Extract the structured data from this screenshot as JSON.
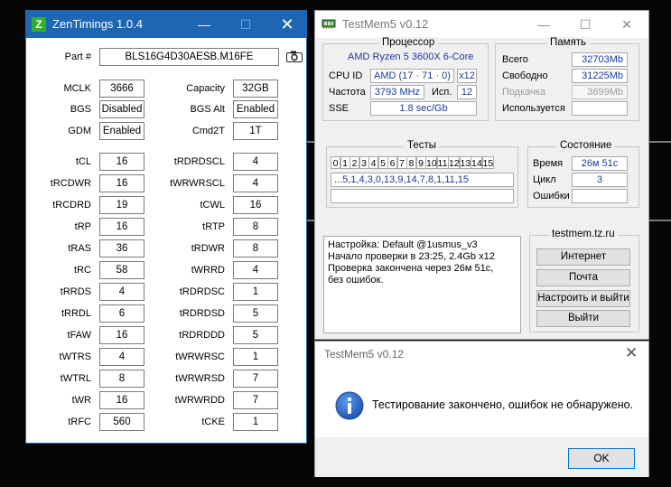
{
  "zentimings": {
    "title": "ZenTimings 1.0.4",
    "logo_letter": "Z",
    "controls": {
      "minimize": "—",
      "maximize": "☐",
      "close": "✕"
    },
    "part_label": "Part #",
    "part_value": "BLS16G4D30AESB.M16FE",
    "top_rows": [
      {
        "l_label": "MCLK",
        "l_value": "3666",
        "r_label": "Capacity",
        "r_value": "32GB"
      },
      {
        "l_label": "BGS",
        "l_value": "Disabled",
        "r_label": "BGS Alt",
        "r_value": "Enabled"
      },
      {
        "l_label": "GDM",
        "l_value": "Enabled",
        "r_label": "Cmd2T",
        "r_value": "1T"
      }
    ],
    "timing_rows": [
      {
        "l_label": "tCL",
        "l_value": "16",
        "r_label": "tRDRDSCL",
        "r_value": "4"
      },
      {
        "l_label": "tRCDWR",
        "l_value": "16",
        "r_label": "tWRWRSCL",
        "r_value": "4"
      },
      {
        "l_label": "tRCDRD",
        "l_value": "19",
        "r_label": "tCWL",
        "r_value": "16"
      },
      {
        "l_label": "tRP",
        "l_value": "16",
        "r_label": "tRTP",
        "r_value": "8"
      },
      {
        "l_label": "tRAS",
        "l_value": "36",
        "r_label": "tRDWR",
        "r_value": "8"
      },
      {
        "l_label": "tRC",
        "l_value": "58",
        "r_label": "tWRRD",
        "r_value": "4"
      },
      {
        "l_label": "tRRDS",
        "l_value": "4",
        "r_label": "tRDRDSC",
        "r_value": "1"
      },
      {
        "l_label": "tRRDL",
        "l_value": "6",
        "r_label": "tRDRDSD",
        "r_value": "5"
      },
      {
        "l_label": "tFAW",
        "l_value": "16",
        "r_label": "tRDRDDD",
        "r_value": "5"
      },
      {
        "l_label": "tWTRS",
        "l_value": "4",
        "r_label": "tWRWRSC",
        "r_value": "1"
      },
      {
        "l_label": "tWTRL",
        "l_value": "8",
        "r_label": "tWRWRSD",
        "r_value": "7"
      },
      {
        "l_label": "tWR",
        "l_value": "16",
        "r_label": "tWRWRDD",
        "r_value": "7"
      },
      {
        "l_label": "tRFC",
        "l_value": "560",
        "r_label": "tCKE",
        "r_value": "1"
      }
    ]
  },
  "testmem": {
    "title": "TestMem5 v0.12",
    "controls": {
      "minimize": "—",
      "maximize": "☐",
      "close": "✕"
    },
    "processor": {
      "title": "Процессор",
      "name": "AMD Ryzen 5 3600X 6-Core",
      "cpuid_label": "CPU ID",
      "cpuid_value": "AMD  (17 · 71 · 0)",
      "threads_value": "x12",
      "freq_label": "Частота",
      "freq_value": "3793 MHz",
      "used_label": "Исп.",
      "used_value": "12",
      "sse_label": "SSE",
      "sse_value": "1.8 sec/Gb"
    },
    "memory": {
      "title": "Память",
      "total_label": "Всего",
      "total_value": "32703Mb",
      "free_label": "Свободно",
      "free_value": "31225Mb",
      "swap_label": "Подкачка",
      "swap_value": "3699Mb",
      "inuse_label": "Используется",
      "inuse_value": ""
    },
    "tests": {
      "title": "Тесты",
      "numbers": [
        "0",
        "1",
        "2",
        "3",
        "4",
        "5",
        "6",
        "7",
        "8",
        "9",
        "10",
        "11",
        "12",
        "13",
        "14",
        "15"
      ],
      "sequence": "...5,1,4,3,0,13,9,14,7,8,1,11,15",
      "extra": ""
    },
    "status": {
      "title": "Состояние",
      "time_label": "Время",
      "time_value": "26м 51с",
      "cycle_label": "Цикл",
      "cycle_value": "3",
      "errors_label": "Ошибки",
      "errors_value": ""
    },
    "log": {
      "line1": "Настройка: Default @1usmus_v3",
      "line2": "Начало проверки в 23:25, 2.4Gb x12",
      "line3": "Проверка закончена через 26м 51с,",
      "line4": "без ошибок."
    },
    "links": {
      "title": "testmem.tz.ru",
      "internet": "Интернет",
      "mail": "Почта",
      "configure": "Настроить и выйти",
      "exit": "Выйти"
    }
  },
  "dialog": {
    "title": "TestMem5 v0.12",
    "close": "✕",
    "icon_glyph": "i",
    "message": "Тестирование закончено, ошибок не обнаружено.",
    "ok": "OK"
  },
  "colors": {
    "zen_titlebar": "#1c66b4",
    "field_text": "#1a3a9a",
    "info_icon": "#1f5fbf",
    "background": "#050505"
  }
}
